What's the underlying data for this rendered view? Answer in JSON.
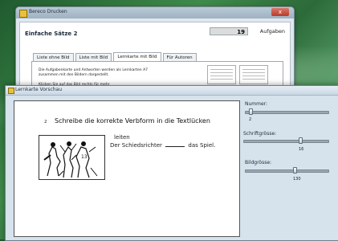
{
  "back_window": {
    "title": "Bereco Drucken",
    "close_label": "x",
    "heading": "Einfache Sätze 2",
    "count": "19",
    "count_label": "Aufgaben",
    "tabs": [
      {
        "label": "Liste ohne Bild"
      },
      {
        "label": "Liste mit Bild"
      },
      {
        "label": "Lernkarte mit Bild"
      },
      {
        "label": "Für Autoren"
      }
    ],
    "active_tab": 2,
    "panel_text_1": "Die Aufgabenkarte und Antworten werden als Lernkarten A7 zusammen mit den Bildern dargestellt.",
    "panel_text_2": "Klicken Sie auf das Bild rechts für mehr Einstellungsmöglichkeiten"
  },
  "front_window": {
    "title": "Lernkarte Vorschau",
    "card": {
      "number": "2",
      "instruction": "Schreibe die korrekte Verbform in die Textlücken",
      "verb": "leiten",
      "sentence_before": "Der Schiedsrichter",
      "sentence_after": "das Spiel."
    },
    "controls": {
      "nummer": {
        "label": "Nummer:",
        "value": "2",
        "fraction": 0.05
      },
      "schriftgroesse": {
        "label": "Schriftgrösse:",
        "value": "16",
        "fraction": 0.68
      },
      "bildgroesse": {
        "label": "Bildgrösse:",
        "value": "130",
        "fraction": 0.6
      }
    }
  }
}
